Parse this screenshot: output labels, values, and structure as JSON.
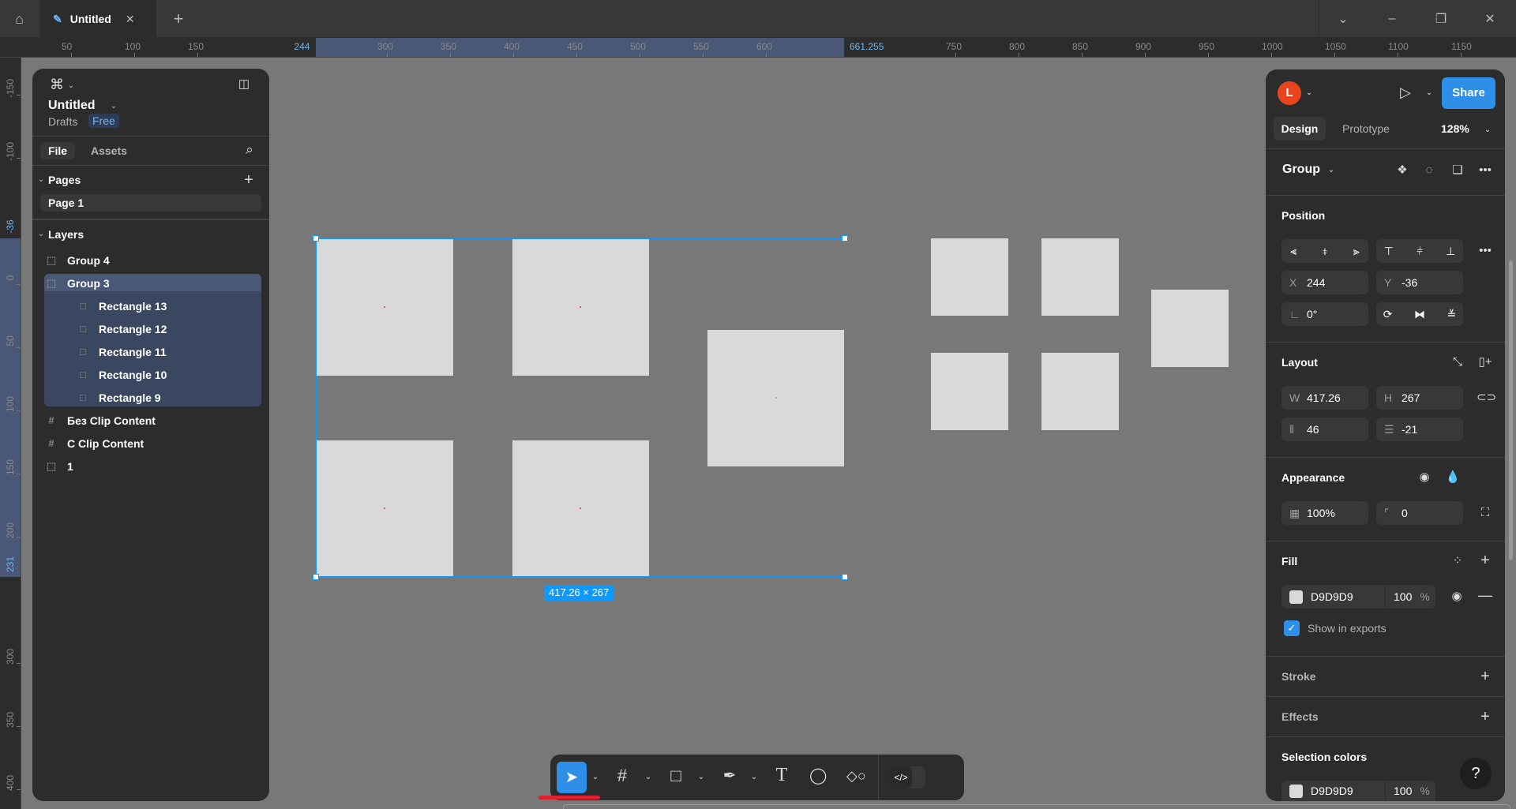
{
  "titlebar": {
    "tab_title": "Untitled",
    "home_icon": "home-icon",
    "file_icon": "figma-file-icon"
  },
  "rulers": {
    "horizontal": [
      "50",
      "100",
      "150",
      "300",
      "350",
      "400",
      "450",
      "500",
      "550",
      "600",
      "750",
      "800",
      "850",
      "900",
      "950",
      "1000",
      "1050",
      "1100",
      "1150"
    ],
    "horizontal_selection": {
      "start": "244",
      "end": "661.255"
    },
    "vertical": [
      "-150",
      "-100",
      "0",
      "50",
      "100",
      "150",
      "200",
      "300",
      "350",
      "400"
    ],
    "vertical_selection": {
      "start": "-36",
      "end": "231"
    }
  },
  "left_panel": {
    "file_name": "Untitled",
    "location": "Drafts",
    "plan_badge": "Free",
    "tabs": [
      {
        "label": "File",
        "active": true
      },
      {
        "label": "Assets",
        "active": false
      }
    ],
    "pages_title": "Pages",
    "pages": [
      {
        "label": "Page 1",
        "active": true
      }
    ],
    "layers_title": "Layers",
    "layers": [
      {
        "label": "Group 4",
        "type": "group",
        "depth": 0,
        "selected": false
      },
      {
        "label": "Group 3",
        "type": "group",
        "depth": 0,
        "selected": true
      },
      {
        "label": "Rectangle 13",
        "type": "rectangle",
        "depth": 1,
        "selected": true
      },
      {
        "label": "Rectangle 12",
        "type": "rectangle",
        "depth": 1,
        "selected": true
      },
      {
        "label": "Rectangle 11",
        "type": "rectangle",
        "depth": 1,
        "selected": true
      },
      {
        "label": "Rectangle 10",
        "type": "rectangle",
        "depth": 1,
        "selected": true
      },
      {
        "label": "Rectangle 9",
        "type": "rectangle",
        "depth": 1,
        "selected": true
      },
      {
        "label": "Без Clip Content",
        "type": "frame",
        "depth": 0,
        "selected": false
      },
      {
        "label": "С Clip Content",
        "type": "frame",
        "depth": 0,
        "selected": false
      },
      {
        "label": "1",
        "type": "group",
        "depth": 0,
        "selected": false
      }
    ]
  },
  "canvas": {
    "selection_size": "417.26 × 267",
    "selection_color": "#0d99ff",
    "rect_fill": "#D9D9D9"
  },
  "toolbar": {
    "tools": [
      "move",
      "frame",
      "rectangle",
      "pen",
      "text",
      "comment",
      "actions"
    ],
    "active": "move",
    "dev_mode_icon": "code-icon",
    "accent": "#2d8fe8"
  },
  "right_panel": {
    "avatar_letter": "L",
    "avatar_color": "#e8451e",
    "share_label": "Share",
    "tabs": [
      {
        "label": "Design",
        "active": true
      },
      {
        "label": "Prototype",
        "active": false
      }
    ],
    "zoom": "128%",
    "selection_type": "Group",
    "position": {
      "title": "Position",
      "x_label": "X",
      "x": "244",
      "y_label": "Y",
      "y": "-36",
      "rotation": "0°"
    },
    "layout": {
      "title": "Layout",
      "w_label": "W",
      "w": "417.26",
      "h_label": "H",
      "h": "267",
      "gap_h": "46",
      "gap_v": "-21"
    },
    "appearance": {
      "title": "Appearance",
      "opacity": "100%",
      "radius": "0"
    },
    "fill": {
      "title": "Fill",
      "hex": "D9D9D9",
      "opacity": "100",
      "unit": "%",
      "show_in_exports": "Show in exports",
      "show_in_exports_checked": true
    },
    "stroke": {
      "title": "Stroke"
    },
    "effects": {
      "title": "Effects"
    },
    "selection_colors": {
      "title": "Selection colors",
      "hex": "D9D9D9",
      "opacity": "100",
      "unit": "%"
    },
    "help": "?"
  }
}
